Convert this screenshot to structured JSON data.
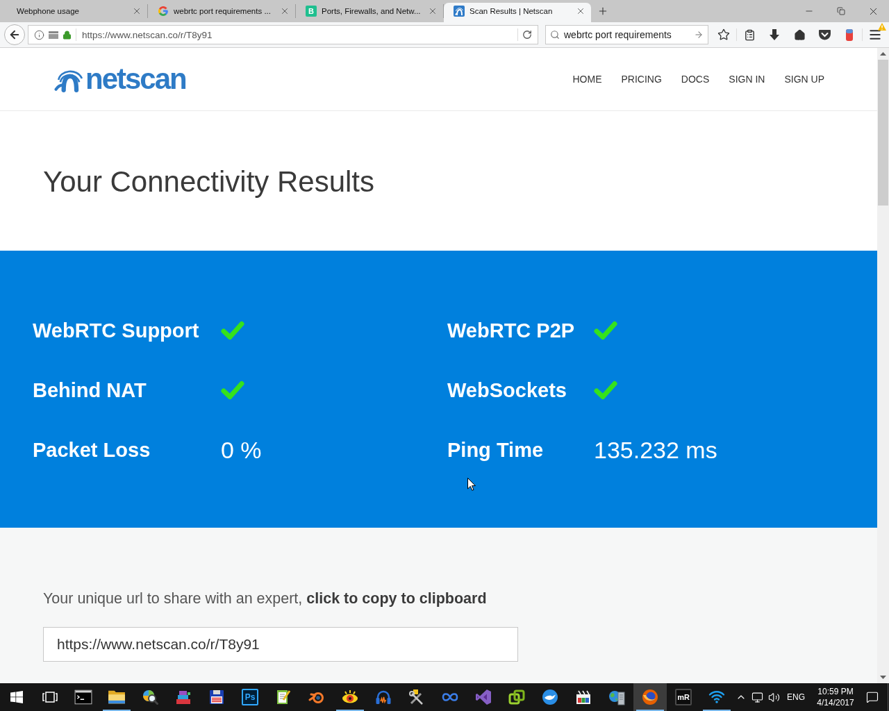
{
  "browser": {
    "tabs": [
      {
        "title": "Webphone usage",
        "kind": "none",
        "selected": false
      },
      {
        "title": "webrtc port requirements ...",
        "kind": "ring",
        "selected": false
      },
      {
        "title": "Ports, Firewalls, and Netw...",
        "kind": "letter",
        "glyph": "B",
        "selected": false
      },
      {
        "title": "Scan Results | Netscan",
        "kind": "wave",
        "selected": true
      }
    ],
    "address_bar": {
      "url": "https://www.netscan.co/r/T8y91"
    },
    "search_field": {
      "value": "webrtc port requirements"
    }
  },
  "site": {
    "logo": "netscan",
    "nav": [
      "HOME",
      "PRICING",
      "DOCS",
      "SIGN IN",
      "SIGN UP"
    ]
  },
  "heading": "Your Connectivity Results",
  "results": [
    {
      "label": "WebRTC Support",
      "kind": "check",
      "passed": true
    },
    {
      "label": "WebRTC P2P",
      "kind": "check",
      "passed": true
    },
    {
      "label": "Behind NAT",
      "kind": "check",
      "passed": true
    },
    {
      "label": "WebSockets",
      "kind": "check",
      "passed": true
    },
    {
      "label": "Packet Loss",
      "kind": "value",
      "value": "0 %"
    },
    {
      "label": "Ping Time",
      "kind": "value",
      "value": "135.232 ms"
    }
  ],
  "share": {
    "text": "Your unique url to share with an expert, **click to copy to clipboard**",
    "url": "https://www.netscan.co/r/T8y91"
  },
  "taskbar": {
    "apps": [
      {
        "kind": "terminal",
        "running": false,
        "selected": false
      },
      {
        "kind": "folder",
        "running": true,
        "selected": false
      },
      {
        "kind": "globe-search",
        "running": false,
        "selected": false
      },
      {
        "kind": "books",
        "running": false,
        "selected": false
      },
      {
        "kind": "floppy",
        "running": false,
        "selected": false
      },
      {
        "kind": "blue-tile",
        "glyph": "Ps",
        "running": false,
        "selected": false
      },
      {
        "kind": "notepad",
        "running": false,
        "selected": false
      },
      {
        "kind": "ring",
        "running": false,
        "selected": false
      },
      {
        "kind": "eye",
        "running": true,
        "selected": false
      },
      {
        "kind": "headphones",
        "running": false,
        "selected": false
      },
      {
        "kind": "tools",
        "running": false,
        "selected": false
      },
      {
        "kind": "infinity",
        "running": false,
        "selected": false
      },
      {
        "kind": "bow",
        "running": false,
        "selected": false
      },
      {
        "kind": "linked-squares",
        "running": false,
        "selected": false
      },
      {
        "kind": "bird",
        "running": false,
        "selected": false
      },
      {
        "kind": "clapper",
        "running": false,
        "selected": false
      },
      {
        "kind": "globe-server",
        "running": false,
        "selected": false
      },
      {
        "kind": "fox-globe",
        "running": true,
        "selected": true
      },
      {
        "kind": "dark-tile",
        "glyph": "mR",
        "running": false,
        "selected": false
      },
      {
        "kind": "wifi",
        "running": true,
        "selected": false
      }
    ],
    "language": "ENG",
    "time": "10:59 PM",
    "date": "4/14/2017"
  }
}
